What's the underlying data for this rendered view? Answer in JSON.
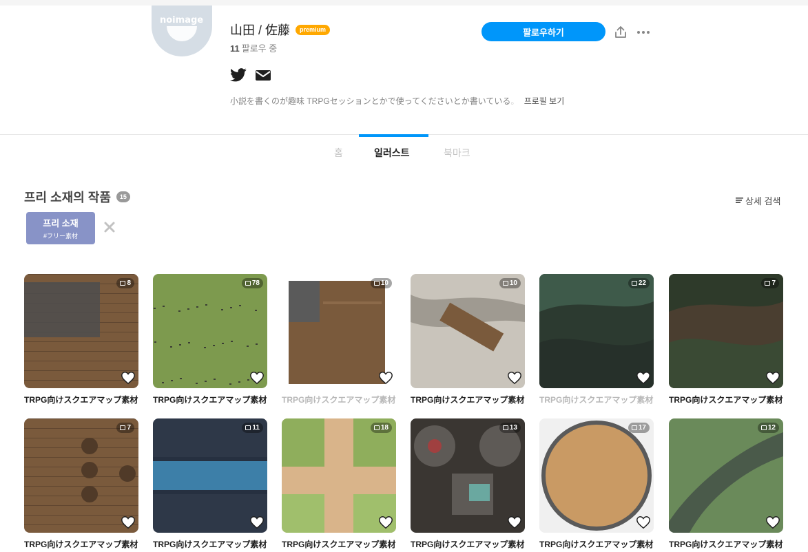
{
  "profile": {
    "avatar_text": "noimage",
    "name": "山田 / 佐藤",
    "premium_label": "premium",
    "following_count": "11",
    "following_label": "팔로우 중",
    "bio": "小説を書くのが趣味 TRPGセッションとかで使ってくださいとか書いている",
    "bio_fade": "。",
    "bio_more": "프로필 보기",
    "follow_button": "팔로우하기",
    "social_icons": [
      "twitter-icon",
      "mail-icon"
    ]
  },
  "tabs": [
    {
      "label": "홈",
      "active": false
    },
    {
      "label": "일러스트",
      "active": true
    },
    {
      "label": "북마크",
      "active": false
    }
  ],
  "section": {
    "title": "프리 소재의 작품",
    "count": "15",
    "detail_search": "상세 검색"
  },
  "tag": {
    "label": "프리 소재",
    "sub": "#フリー素材"
  },
  "colors": {
    "accent": "#0096fa",
    "premium": "#ffa800",
    "tag": "#8893c7"
  },
  "works": [
    {
      "title": "TRPG向けスクエアマップ素材",
      "pages": "8",
      "muted": false,
      "theme": "wood"
    },
    {
      "title": "TRPG向けスクエアマップ素材",
      "pages": "78",
      "muted": false,
      "theme": "grass"
    },
    {
      "title": "TRPG向けスクエアマップ素材",
      "pages": "10",
      "muted": true,
      "theme": "house"
    },
    {
      "title": "TRPG向けスクエアマップ素材",
      "pages": "10",
      "muted": false,
      "theme": "rock"
    },
    {
      "title": "TRPG向けスクエアマップ素材",
      "pages": "22",
      "muted": true,
      "theme": "swamp"
    },
    {
      "title": "TRPG向けスクエアマップ素材",
      "pages": "7",
      "muted": false,
      "theme": "forest"
    },
    {
      "title": "TRPG向けスクエアマップ素材",
      "pages": "7",
      "muted": false,
      "theme": "tavern"
    },
    {
      "title": "TRPG向けスクエアマップ素材",
      "pages": "11",
      "muted": false,
      "theme": "river"
    },
    {
      "title": "TRPG向けスクエアマップ素材",
      "pages": "18",
      "muted": false,
      "theme": "path"
    },
    {
      "title": "TRPG向けスクエアマップ素材",
      "pages": "13",
      "muted": false,
      "theme": "dungeon"
    },
    {
      "title": "TRPG向けスクエアマップ素材",
      "pages": "17",
      "muted": false,
      "theme": "arena"
    },
    {
      "title": "TRPG向けスクエアマップ素材",
      "pages": "12",
      "muted": false,
      "theme": "road"
    }
  ]
}
